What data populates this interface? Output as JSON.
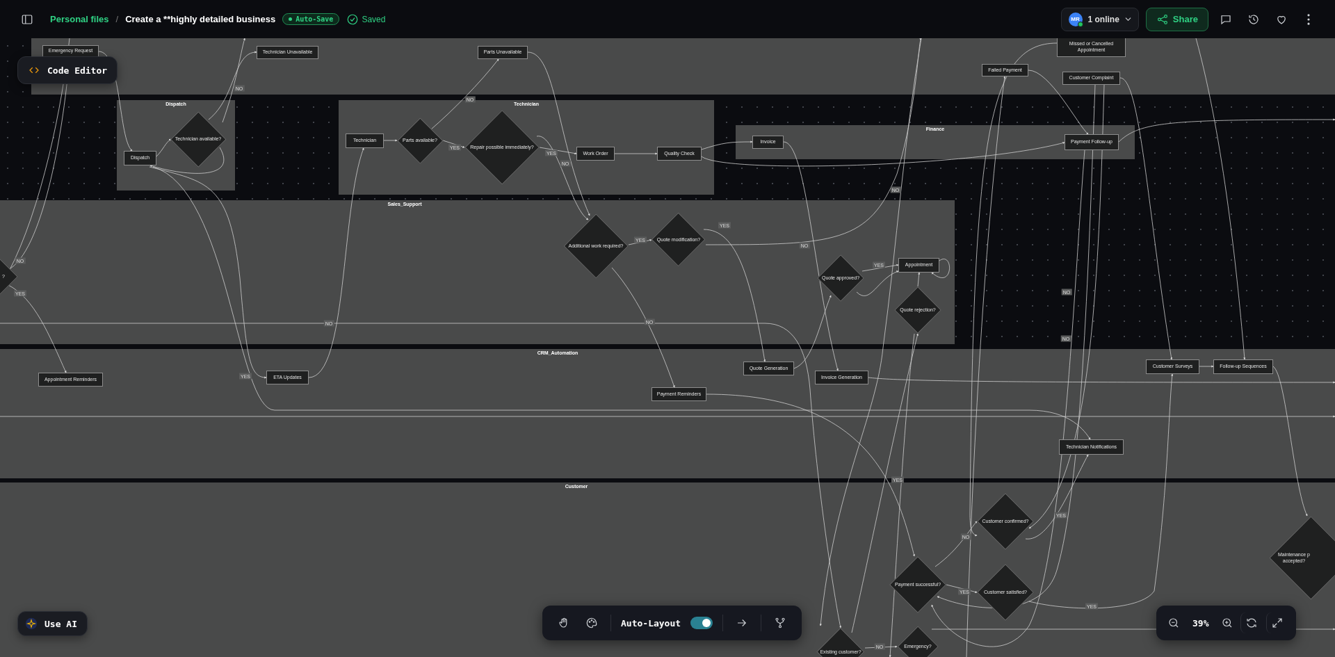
{
  "header": {
    "breadcrumb": "Personal files",
    "separator": "/",
    "title": "Create a **highly detailed business",
    "auto_save": "Auto-Save",
    "status": "Saved",
    "avatar": "MR",
    "presence": "1 online",
    "share": "Share"
  },
  "code_editor_button": "Code Editor",
  "lanes": [
    {
      "label": "Dispatch"
    },
    {
      "label": "Technician"
    },
    {
      "label": "Finance"
    },
    {
      "label": "Sales_Support"
    },
    {
      "label": "CRM_Automation"
    },
    {
      "label": "Customer"
    }
  ],
  "nodes": [
    {
      "kind": "task",
      "label": "Emergency Request"
    },
    {
      "kind": "task",
      "label": "Technician Unavailable"
    },
    {
      "kind": "task",
      "label": "Parts Unavailable"
    },
    {
      "kind": "task",
      "label": "Missed or Cancelled Appointment"
    },
    {
      "kind": "task",
      "label": "Failed Payment"
    },
    {
      "kind": "task",
      "label": "Customer Complaint"
    },
    {
      "kind": "decision",
      "label": "Technician available?"
    },
    {
      "kind": "task",
      "label": "Dispatch"
    },
    {
      "kind": "task",
      "label": "Technician"
    },
    {
      "kind": "decision",
      "label": "Parts available?"
    },
    {
      "kind": "decision",
      "label": "Repair possible immediately?"
    },
    {
      "kind": "task",
      "label": "Work Order"
    },
    {
      "kind": "task",
      "label": "Quality Check"
    },
    {
      "kind": "task",
      "label": "Invoice"
    },
    {
      "kind": "task",
      "label": "Payment Follow-up"
    },
    {
      "kind": "decision",
      "label": "?"
    },
    {
      "kind": "decision",
      "label": "Additional work required?"
    },
    {
      "kind": "decision",
      "label": "Quote modification?"
    },
    {
      "kind": "decision",
      "label": "Quote approved?"
    },
    {
      "kind": "task",
      "label": "Appointment"
    },
    {
      "kind": "decision",
      "label": "Quote rejection?"
    },
    {
      "kind": "task",
      "label": "Appointment Reminders"
    },
    {
      "kind": "task",
      "label": "ETA Updates"
    },
    {
      "kind": "task",
      "label": "Quote Generation"
    },
    {
      "kind": "task",
      "label": "Invoice Generation"
    },
    {
      "kind": "task",
      "label": "Payment Reminders"
    },
    {
      "kind": "task",
      "label": "Customer Surveys"
    },
    {
      "kind": "task",
      "label": "Follow-up Sequences"
    },
    {
      "kind": "task",
      "label": "Technician Notifications"
    },
    {
      "kind": "decision",
      "label": "Customer confirmed?"
    },
    {
      "kind": "decision",
      "label": "Payment successful?"
    },
    {
      "kind": "decision",
      "label": "Customer satisfied?"
    },
    {
      "kind": "decision",
      "label": "Maintenance p accepted?"
    },
    {
      "kind": "decision",
      "label": "Existing customer?"
    },
    {
      "kind": "decision",
      "label": "Emergency?"
    }
  ],
  "edge_labels": [
    "NO",
    "NO",
    "YES",
    "YES",
    "NO",
    "NO",
    "YES",
    "YES",
    "YES",
    "NO",
    "YES",
    "NO",
    "NO",
    "NO",
    "NO",
    "NO",
    "YES",
    "YES",
    "YES",
    "NO",
    "YES",
    "YES",
    "NO"
  ],
  "use_ai_button": "Use AI",
  "toolbar": {
    "auto_layout": {
      "label": "Auto-Layout",
      "on": true
    }
  },
  "zoom": {
    "value": "39%"
  }
}
